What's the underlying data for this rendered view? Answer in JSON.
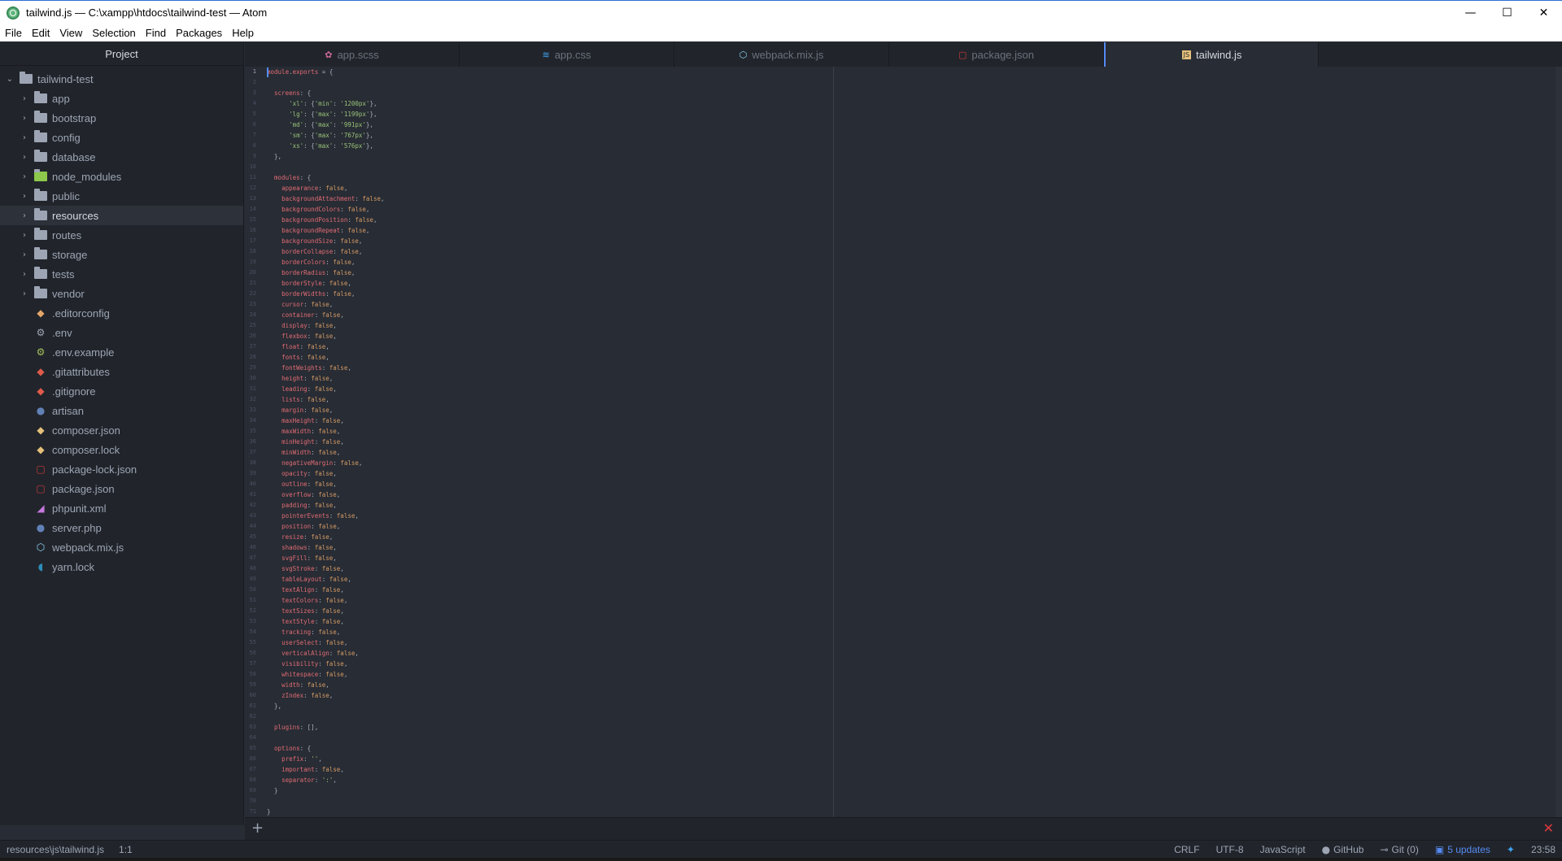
{
  "window": {
    "title": "tailwind.js — C:\\xampp\\htdocs\\tailwind-test — Atom",
    "minimize": "—",
    "maximize": "☐",
    "close": "✕"
  },
  "menu": [
    "File",
    "Edit",
    "View",
    "Selection",
    "Find",
    "Packages",
    "Help"
  ],
  "tree": {
    "header": "Project",
    "root": "tailwind-test",
    "folders": [
      "app",
      "bootstrap",
      "config",
      "database",
      "node_modules",
      "public",
      "resources",
      "routes",
      "storage",
      "tests",
      "vendor"
    ],
    "selected": "resources",
    "files": [
      {
        "name": ".editorconfig",
        "icon": "editorconfig-icon",
        "color": "#e5a66b"
      },
      {
        "name": ".env",
        "icon": "gear-icon",
        "color": "#9da5b4"
      },
      {
        "name": ".env.example",
        "icon": "gear-icon",
        "color": "#a6c05b"
      },
      {
        "name": ".gitattributes",
        "icon": "git-icon",
        "color": "#e05b4b"
      },
      {
        "name": ".gitignore",
        "icon": "git-icon",
        "color": "#e05b4b"
      },
      {
        "name": "artisan",
        "icon": "php-icon",
        "color": "#6181b6"
      },
      {
        "name": "composer.json",
        "icon": "composer-icon",
        "color": "#e5c07b"
      },
      {
        "name": "composer.lock",
        "icon": "composer-icon",
        "color": "#e5c07b"
      },
      {
        "name": "package-lock.json",
        "icon": "npm-icon",
        "color": "#cb3837"
      },
      {
        "name": "package.json",
        "icon": "npm-icon",
        "color": "#cb3837"
      },
      {
        "name": "phpunit.xml",
        "icon": "phpunit-icon",
        "color": "#c678dd"
      },
      {
        "name": "server.php",
        "icon": "php-icon",
        "color": "#6181b6"
      },
      {
        "name": "webpack.mix.js",
        "icon": "webpack-icon",
        "color": "#8ed6fb"
      },
      {
        "name": "yarn.lock",
        "icon": "yarn-icon",
        "color": "#2c8ebb"
      }
    ]
  },
  "tabs": [
    {
      "label": "app.scss",
      "icon": "sass-icon",
      "color": "#cd6799"
    },
    {
      "label": "app.css",
      "icon": "css-icon",
      "color": "#42a5f5"
    },
    {
      "label": "webpack.mix.js",
      "icon": "webpack-icon",
      "color": "#8ed6fb"
    },
    {
      "label": "package.json",
      "icon": "npm-icon",
      "color": "#cb3837"
    },
    {
      "label": "tailwind.js",
      "icon": "js-icon",
      "color": "#e5c07b"
    }
  ],
  "active_tab": "tailwind.js",
  "code": {
    "screens": [
      [
        "xl",
        "min",
        "1200px"
      ],
      [
        "lg",
        "max",
        "1199px"
      ],
      [
        "md",
        "max",
        "991px"
      ],
      [
        "sm",
        "max",
        "767px"
      ],
      [
        "xs",
        "max",
        "576px"
      ]
    ],
    "modules": [
      "appearance",
      "backgroundAttachment",
      "backgroundColors",
      "backgroundPosition",
      "backgroundRepeat",
      "backgroundSize",
      "borderCollapse",
      "borderColors",
      "borderRadius",
      "borderStyle",
      "borderWidths",
      "cursor",
      "container",
      "display",
      "flexbox",
      "float",
      "fonts",
      "fontWeights",
      "height",
      "leading",
      "lists",
      "margin",
      "maxHeight",
      "maxWidth",
      "minHeight",
      "minWidth",
      "negativeMargin",
      "opacity",
      "outline",
      "overflow",
      "padding",
      "pointerEvents",
      "position",
      "resize",
      "shadows",
      "svgFill",
      "svgStroke",
      "tableLayout",
      "textAlign",
      "textColors",
      "textSizes",
      "textStyle",
      "tracking",
      "userSelect",
      "verticalAlign",
      "visibility",
      "whitespace",
      "width",
      "zIndex"
    ],
    "options": [
      [
        "prefix",
        "''"
      ],
      [
        "important",
        "false"
      ],
      [
        "separator",
        "':'"
      ]
    ]
  },
  "status": {
    "path": "resources\\js\\tailwind.js",
    "cursor": "1:1",
    "line_ending": "CRLF",
    "encoding": "UTF-8",
    "grammar": "JavaScript",
    "github": "GitHub",
    "git": "Git (0)",
    "updates": "5 updates",
    "time": "23:58"
  }
}
